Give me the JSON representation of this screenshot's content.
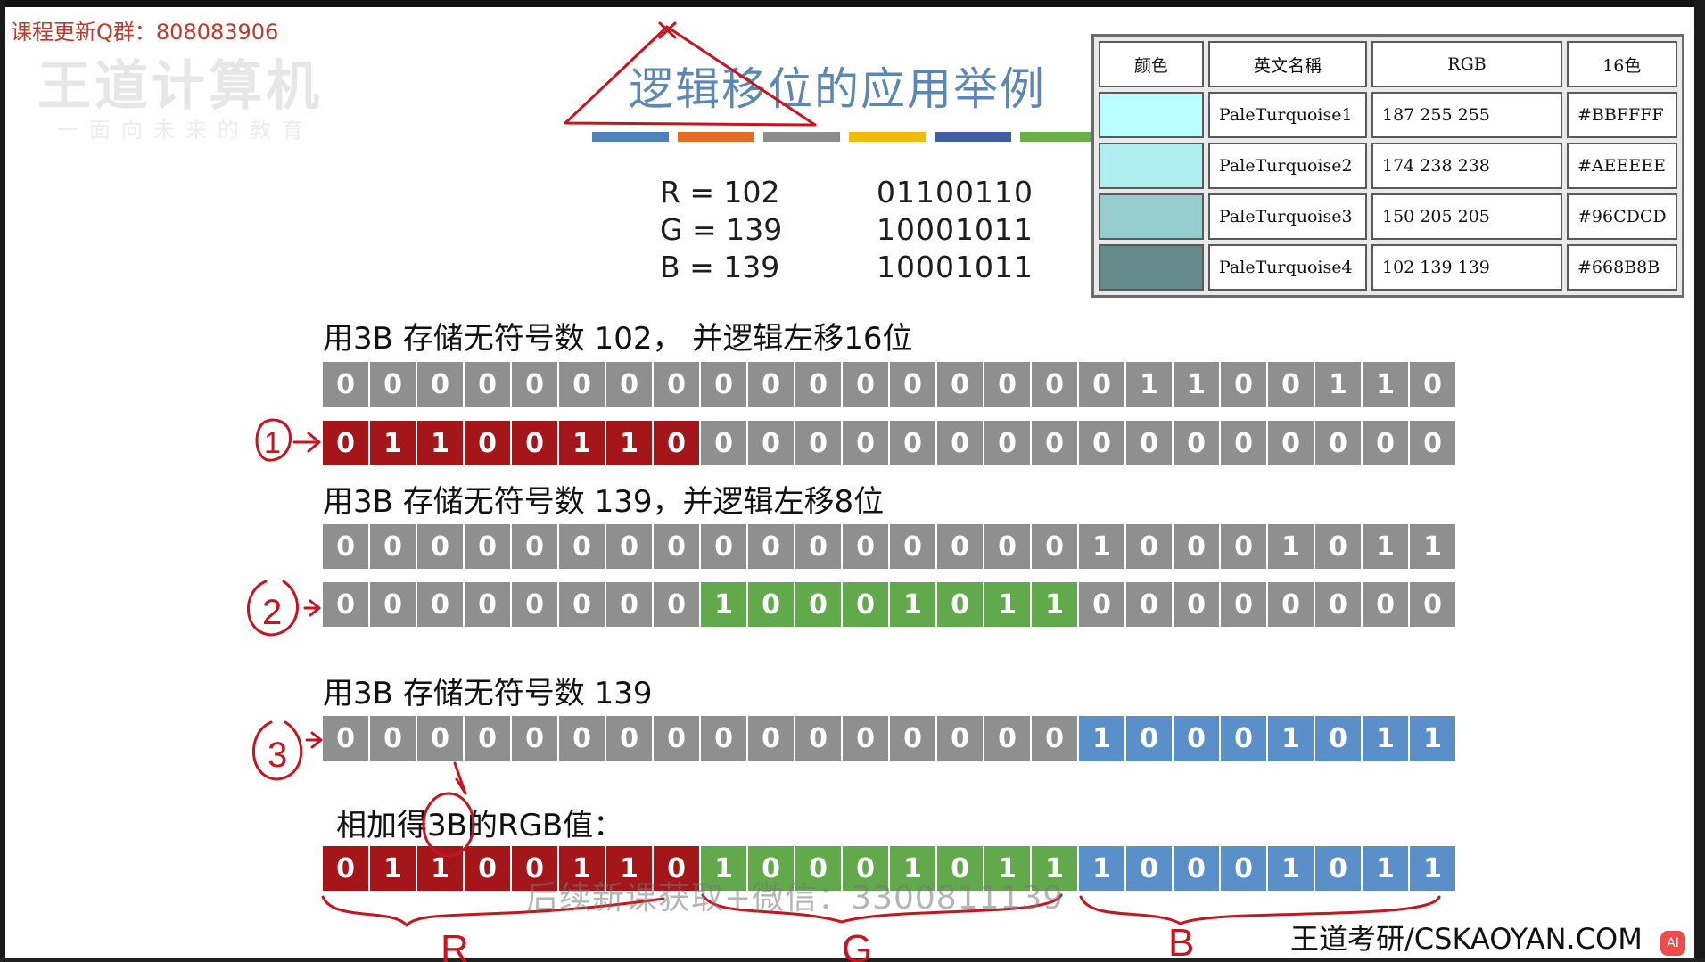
{
  "header": {
    "course_update": "课程更新Q群：808083906",
    "title": "逻辑移位的应用举例"
  },
  "colors": {
    "red": "#a4161a",
    "green": "#61a94b",
    "blue": "#5b8fc9",
    "gray": "#8f8f8f",
    "title": "#5b87b5",
    "palette": [
      "#4f81bd",
      "#e46c25",
      "#8c8c8c",
      "#f2b80c",
      "#3f5ea8",
      "#6aaf45"
    ]
  },
  "rgb": {
    "r_label": "R = 102",
    "g_label": "G = 139",
    "b_label": "B = 139",
    "r_bin": "01100110",
    "g_bin": "10001011",
    "b_bin": "10001011"
  },
  "table": {
    "headers": [
      "颜色",
      "英文名稱",
      "RGB",
      "16色"
    ],
    "rows": [
      {
        "swatch": "#BBFFFF",
        "name": "PaleTurquoise1",
        "rgb": "187 255 255",
        "hex": "#BBFFFF"
      },
      {
        "swatch": "#AEEEEE",
        "name": "PaleTurquoise2",
        "rgb": "174 238 238",
        "hex": "#AEEEEE"
      },
      {
        "swatch": "#96CDCD",
        "name": "PaleTurquoise3",
        "rgb": "150 205 205",
        "hex": "#96CDCD"
      },
      {
        "swatch": "#668B8B",
        "name": "PaleTurquoise4",
        "rgb": "102 139 139",
        "hex": "#668B8B"
      }
    ]
  },
  "sections": {
    "s1": "用3B 存储无符号数 102， 并逻辑左移16位",
    "s2": "用3B 存储无符号数 139，并逻辑左移8位",
    "s3": "用3B 存储无符号数 139",
    "s4": "相加得3B的RGB值："
  },
  "rows": [
    {
      "bits": "000000000000000001100110",
      "colors": "gggggggggggggggggggggggg"
    },
    {
      "bits": "011001100000000000000000",
      "colors": "rrrrrrrrgggggggggggggggg"
    },
    {
      "bits": "000000000000000010001011",
      "colors": "gggggggggggggggggggggggg"
    },
    {
      "bits": "000000001000101100000000",
      "colors": "ggggggggGGGGGGGGgggggggg"
    },
    {
      "bits": "000000000000000010001011",
      "colors": "ggggggggggggggggbbbbbbbb"
    },
    {
      "bits": "011001101000101110001011",
      "colors": "rrrrrrrrGGGGGGGGbbbbbbbb"
    }
  ],
  "annotations": {
    "circle_1": "1",
    "circle_2": "2",
    "circle_3": "3",
    "brace_r": "R",
    "brace_g": "G",
    "brace_b": "B"
  },
  "footer": {
    "watermark": "后续新课获取+微信：3300811139",
    "brand": "王道考研/CSKAOYAN.COM",
    "ghost_logo": "王道计算机",
    "ghost_sub": "一面向未来的教育",
    "ai_badge": "AI"
  }
}
